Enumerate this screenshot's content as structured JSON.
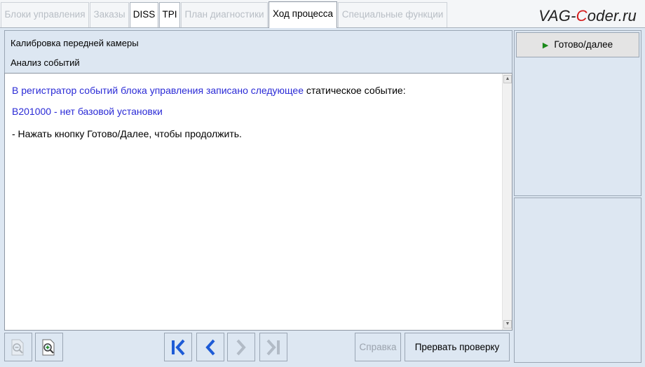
{
  "tabs": [
    {
      "label": "Блоки управления",
      "state": "disabled"
    },
    {
      "label": "Заказы",
      "state": "disabled"
    },
    {
      "label": "DISS",
      "state": "enabled"
    },
    {
      "label": "TPI",
      "state": "enabled"
    },
    {
      "label": "План диагностики",
      "state": "disabled"
    },
    {
      "label": "Ход процесса",
      "state": "active"
    },
    {
      "label": "Специальные функции",
      "state": "disabled"
    }
  ],
  "logo": {
    "prefix": "VAG-",
    "accent": "C",
    "suffix": "oder.ru"
  },
  "header": {
    "line1": "Калибровка передней камеры",
    "line2": "Анализ событий"
  },
  "content": {
    "line1_blue": "В регистратор событий блока управления записано следующее",
    "line1_black": " статическое событие:",
    "line2": "B201000 - нет базовой установки",
    "line3": "- Нажать кнопку Готово/Далее, чтобы продолжить."
  },
  "toolbar": {
    "help_label": "Справка",
    "abort_label": "Прервать проверку"
  },
  "right_panel": {
    "done_label": "Готово/далее"
  },
  "colors": {
    "background": "#dde7f2",
    "blue_text": "#2a2ad6",
    "nav_blue": "#1d5bd6",
    "play_green": "#1a8a1a"
  },
  "icons": [
    "zoom-out-icon",
    "zoom-in-icon",
    "first-icon",
    "back-icon",
    "forward-icon",
    "last-icon",
    "play-icon"
  ]
}
